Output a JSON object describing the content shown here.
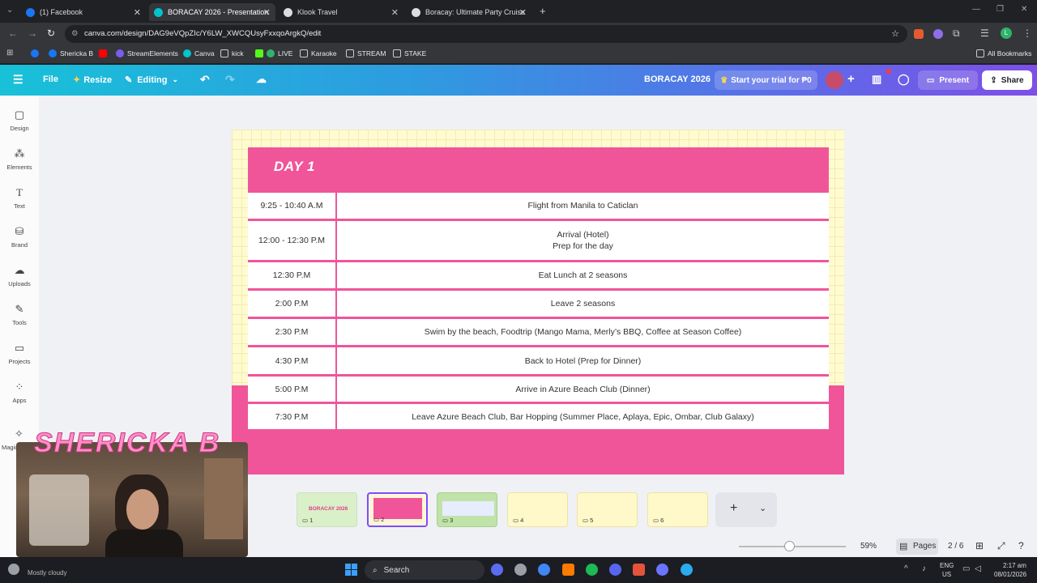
{
  "browser": {
    "tabs": [
      {
        "label": "(1) Facebook",
        "color": "#1877f2"
      },
      {
        "label": "BORACAY 2026 - Presentation",
        "color": "#00c4cc",
        "active": true
      },
      {
        "label": "Klook Travel",
        "color": "#ff5b00"
      },
      {
        "label": "Boracay: Ultimate Party Cruise I",
        "color": "#ff5b00"
      }
    ],
    "url": "canva.com/design/DAG9eVQpZIc/Y6LW_XWCQUsyFxxqoArgkQ/edit",
    "bookmarks": [
      "Shericka B",
      "StreamElements",
      "Canva",
      "kick",
      "LIVE",
      "Karaoke",
      "STREAM",
      "STAKE"
    ],
    "all_bookmarks": "All Bookmarks",
    "profile_initial": "L"
  },
  "canva": {
    "file": "File",
    "resize": "Resize",
    "editing": "Editing",
    "title": "BORACAY 2026",
    "trial": "Start your trial for ₱0",
    "present": "Present",
    "share": "Share"
  },
  "sidebar": [
    "Design",
    "Elements",
    "Text",
    "Brand",
    "Uploads",
    "Tools",
    "Projects",
    "Apps",
    "Magic"
  ],
  "slide": {
    "day": "DAY 1",
    "rows": [
      {
        "time": "9:25 - 10:40 A.M",
        "activity": "Flight from Manila to Caticlan"
      },
      {
        "time": "12:00 - 12:30 P.M",
        "activity": "Arrival (Hotel)",
        "activity2": "Prep for the day"
      },
      {
        "time": "12:30 P.M",
        "activity": "Eat Lunch at 2 seasons"
      },
      {
        "time": "2:00 P.M",
        "activity": "Leave 2 seasons"
      },
      {
        "time": "2:30 P.M",
        "activity": "Swim by the beach, Foodtrip (Mango Mama, Merly’s BBQ, Coffee at Season Coffee)"
      },
      {
        "time": "4:30 P.M",
        "activity": "Back to Hotel (Prep for Dinner)"
      },
      {
        "time": "5:00 P.M",
        "activity": "Arrive in Azure Beach Club (Dinner)"
      },
      {
        "time": "7:30 P.M",
        "activity": "Leave Azure Beach Club, Bar Hopping (Summer Place, Aplaya, Epic, Ombar, Club Galaxy)"
      }
    ]
  },
  "pages": {
    "thumbs": [
      "1",
      "2",
      "3",
      "4",
      "5",
      "6"
    ],
    "thumb1_title": "BORACAY 2026",
    "zoom": "59%",
    "zoom_fraction": 0.47,
    "pages_label": "Pages",
    "page_counter": "2 / 6"
  },
  "stream": {
    "name": "SHERICKA B",
    "weather": "Mostly cloudy"
  },
  "taskbar": {
    "search": "Search",
    "lang1": "ENG",
    "lang2": "US",
    "time": "2:17 am",
    "date": "08/01/2026"
  }
}
